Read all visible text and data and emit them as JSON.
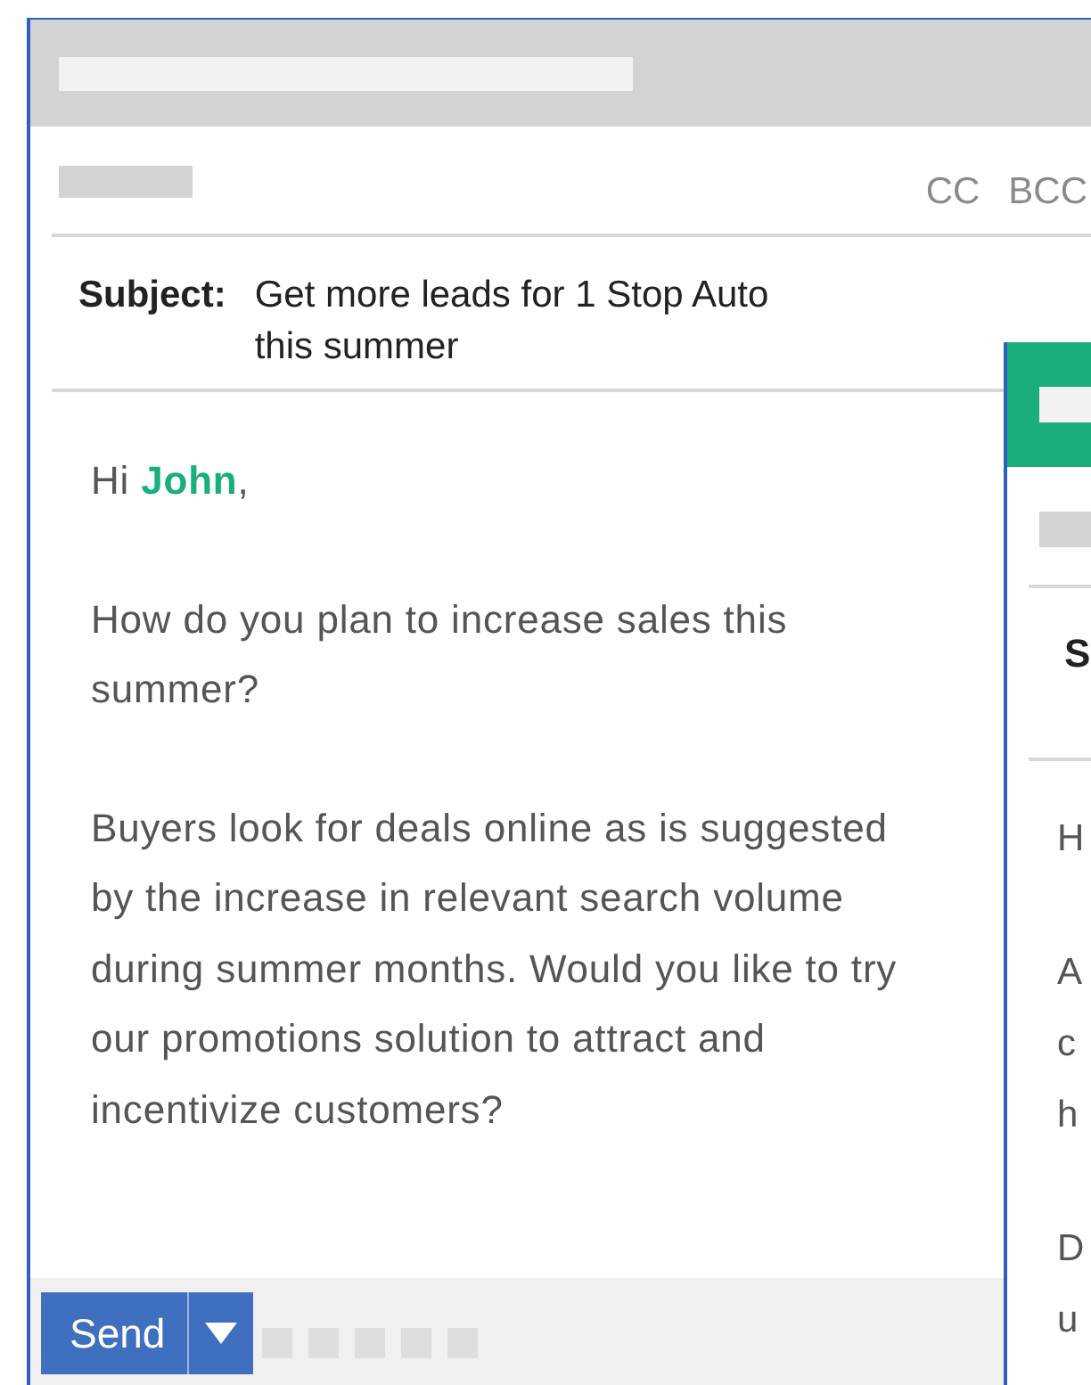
{
  "compose": {
    "cc": "CC",
    "bcc": "BCC",
    "subject_label": "Subject:",
    "subject_lines": [
      "Get more leads for 1 Stop Auto",
      "this summer"
    ],
    "greeting": "Hi **John**,",
    "paragraphs": [
      [
        "How do you plan to increase sales this",
        "summer?"
      ],
      [
        "Buyers look for deals online as is suggested",
        "by the increase in relevant search volume",
        "during summer months. Would you like to try",
        "our promotions solution to attract and",
        "incentivize customers?"
      ]
    ],
    "send": "Send"
  },
  "second_window": {
    "subject_label": "S",
    "paragraphs": [
      [
        "H"
      ],
      [
        "A",
        "c",
        "h"
      ],
      [
        "D",
        "u"
      ]
    ]
  }
}
